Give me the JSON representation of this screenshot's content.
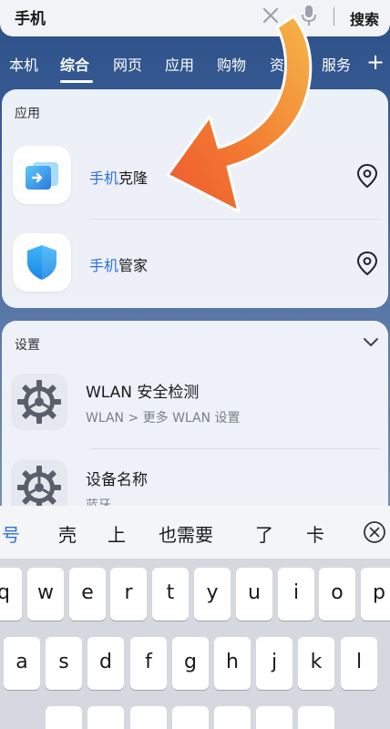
{
  "search": {
    "query": "手机",
    "submit_label": "搜索",
    "icons": {
      "clear": "close-icon",
      "mic": "microphone-icon"
    }
  },
  "tabs": [
    {
      "label": "本机",
      "active": false
    },
    {
      "label": "综合",
      "active": true
    },
    {
      "label": "网页",
      "active": false
    },
    {
      "label": "应用",
      "active": false
    },
    {
      "label": "购物",
      "active": false
    },
    {
      "label": "资讯",
      "active": false
    },
    {
      "label": "服务",
      "active": false
    }
  ],
  "tab_add_label": "+",
  "apps_section": {
    "title": "应用",
    "items": [
      {
        "highlight": "手机",
        "rest": "克隆",
        "icon": "phone-clone-icon"
      },
      {
        "highlight": "手机",
        "rest": "管家",
        "icon": "shield-icon"
      }
    ]
  },
  "settings_section": {
    "title": "设置",
    "items": [
      {
        "title": "WLAN 安全检测",
        "subtitle": "WLAN > 更多 WLAN 设置",
        "icon": "gear-icon"
      },
      {
        "title": "设备名称",
        "subtitle": "蓝牙",
        "icon": "gear-icon"
      }
    ]
  },
  "keyboard": {
    "suggestions": [
      "号",
      "壳",
      "上",
      "也需要",
      "了",
      "卡"
    ],
    "row1": [
      "q",
      "w",
      "e",
      "r",
      "t",
      "y",
      "u",
      "i",
      "o",
      "p"
    ],
    "row2": [
      "a",
      "s",
      "d",
      "f",
      "g",
      "h",
      "j",
      "k",
      "l"
    ]
  },
  "colors": {
    "accent_blue": "#2f6fd8",
    "arrow_orange": "#f26a2e",
    "card_bg": "#f3f5fa"
  }
}
